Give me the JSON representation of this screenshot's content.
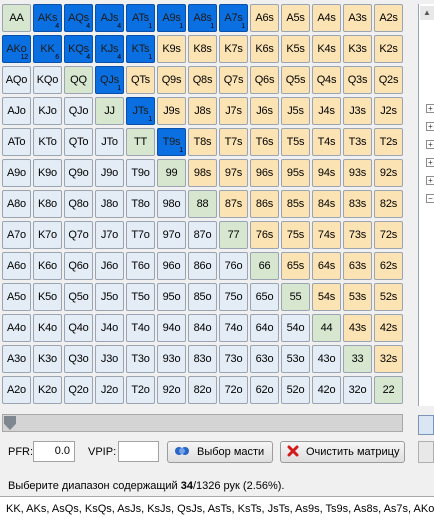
{
  "grid": {
    "rows": [
      [
        [
          "AA",
          "pair",
          false,
          ""
        ],
        [
          "AKs",
          "suited",
          true,
          "4"
        ],
        [
          "AQs",
          "suited",
          true,
          "4"
        ],
        [
          "AJs",
          "suited",
          true,
          "4"
        ],
        [
          "ATs",
          "suited",
          true,
          "1"
        ],
        [
          "A9s",
          "suited",
          true,
          "1"
        ],
        [
          "A8s",
          "suited",
          true,
          "1"
        ],
        [
          "A7s",
          "suited",
          true,
          "1"
        ],
        [
          "A6s",
          "suited",
          false,
          ""
        ],
        [
          "A5s",
          "suited",
          false,
          ""
        ],
        [
          "A4s",
          "suited",
          false,
          ""
        ],
        [
          "A3s",
          "suited",
          false,
          ""
        ],
        [
          "A2s",
          "suited",
          false,
          ""
        ]
      ],
      [
        [
          "AKo",
          "offsuit",
          true,
          "12"
        ],
        [
          "KK",
          "pair",
          true,
          "6"
        ],
        [
          "KQs",
          "suited",
          true,
          "4"
        ],
        [
          "KJs",
          "suited",
          true,
          "4"
        ],
        [
          "KTs",
          "suited",
          true,
          "1"
        ],
        [
          "K9s",
          "suited",
          false,
          ""
        ],
        [
          "K8s",
          "suited",
          false,
          ""
        ],
        [
          "K7s",
          "suited",
          false,
          ""
        ],
        [
          "K6s",
          "suited",
          false,
          ""
        ],
        [
          "K5s",
          "suited",
          false,
          ""
        ],
        [
          "K4s",
          "suited",
          false,
          ""
        ],
        [
          "K3s",
          "suited",
          false,
          ""
        ],
        [
          "K2s",
          "suited",
          false,
          ""
        ]
      ],
      [
        [
          "AQo",
          "offsuit",
          false,
          ""
        ],
        [
          "KQo",
          "offsuit",
          false,
          ""
        ],
        [
          "QQ",
          "pair",
          false,
          ""
        ],
        [
          "QJs",
          "suited",
          true,
          "1"
        ],
        [
          "QTs",
          "suited",
          false,
          ""
        ],
        [
          "Q9s",
          "suited",
          false,
          ""
        ],
        [
          "Q8s",
          "suited",
          false,
          ""
        ],
        [
          "Q7s",
          "suited",
          false,
          ""
        ],
        [
          "Q6s",
          "suited",
          false,
          ""
        ],
        [
          "Q5s",
          "suited",
          false,
          ""
        ],
        [
          "Q4s",
          "suited",
          false,
          ""
        ],
        [
          "Q3s",
          "suited",
          false,
          ""
        ],
        [
          "Q2s",
          "suited",
          false,
          ""
        ]
      ],
      [
        [
          "AJo",
          "offsuit",
          false,
          ""
        ],
        [
          "KJo",
          "offsuit",
          false,
          ""
        ],
        [
          "QJo",
          "offsuit",
          false,
          ""
        ],
        [
          "JJ",
          "pair",
          false,
          ""
        ],
        [
          "JTs",
          "suited",
          true,
          "1"
        ],
        [
          "J9s",
          "suited",
          false,
          ""
        ],
        [
          "J8s",
          "suited",
          false,
          ""
        ],
        [
          "J7s",
          "suited",
          false,
          ""
        ],
        [
          "J6s",
          "suited",
          false,
          ""
        ],
        [
          "J5s",
          "suited",
          false,
          ""
        ],
        [
          "J4s",
          "suited",
          false,
          ""
        ],
        [
          "J3s",
          "suited",
          false,
          ""
        ],
        [
          "J2s",
          "suited",
          false,
          ""
        ]
      ],
      [
        [
          "ATo",
          "offsuit",
          false,
          ""
        ],
        [
          "KTo",
          "offsuit",
          false,
          ""
        ],
        [
          "QTo",
          "offsuit",
          false,
          ""
        ],
        [
          "JTo",
          "offsuit",
          false,
          ""
        ],
        [
          "TT",
          "pair",
          false,
          ""
        ],
        [
          "T9s",
          "suited",
          true,
          "1"
        ],
        [
          "T8s",
          "suited",
          false,
          ""
        ],
        [
          "T7s",
          "suited",
          false,
          ""
        ],
        [
          "T6s",
          "suited",
          false,
          ""
        ],
        [
          "T5s",
          "suited",
          false,
          ""
        ],
        [
          "T4s",
          "suited",
          false,
          ""
        ],
        [
          "T3s",
          "suited",
          false,
          ""
        ],
        [
          "T2s",
          "suited",
          false,
          ""
        ]
      ],
      [
        [
          "A9o",
          "offsuit",
          false,
          ""
        ],
        [
          "K9o",
          "offsuit",
          false,
          ""
        ],
        [
          "Q9o",
          "offsuit",
          false,
          ""
        ],
        [
          "J9o",
          "offsuit",
          false,
          ""
        ],
        [
          "T9o",
          "offsuit",
          false,
          ""
        ],
        [
          "99",
          "pair",
          false,
          ""
        ],
        [
          "98s",
          "suited",
          false,
          ""
        ],
        [
          "97s",
          "suited",
          false,
          ""
        ],
        [
          "96s",
          "suited",
          false,
          ""
        ],
        [
          "95s",
          "suited",
          false,
          ""
        ],
        [
          "94s",
          "suited",
          false,
          ""
        ],
        [
          "93s",
          "suited",
          false,
          ""
        ],
        [
          "92s",
          "suited",
          false,
          ""
        ]
      ],
      [
        [
          "A8o",
          "offsuit",
          false,
          ""
        ],
        [
          "K8o",
          "offsuit",
          false,
          ""
        ],
        [
          "Q8o",
          "offsuit",
          false,
          ""
        ],
        [
          "J8o",
          "offsuit",
          false,
          ""
        ],
        [
          "T8o",
          "offsuit",
          false,
          ""
        ],
        [
          "98o",
          "offsuit",
          false,
          ""
        ],
        [
          "88",
          "pair",
          false,
          ""
        ],
        [
          "87s",
          "suited",
          false,
          ""
        ],
        [
          "86s",
          "suited",
          false,
          ""
        ],
        [
          "85s",
          "suited",
          false,
          ""
        ],
        [
          "84s",
          "suited",
          false,
          ""
        ],
        [
          "83s",
          "suited",
          false,
          ""
        ],
        [
          "82s",
          "suited",
          false,
          ""
        ]
      ],
      [
        [
          "A7o",
          "offsuit",
          false,
          ""
        ],
        [
          "K7o",
          "offsuit",
          false,
          ""
        ],
        [
          "Q7o",
          "offsuit",
          false,
          ""
        ],
        [
          "J7o",
          "offsuit",
          false,
          ""
        ],
        [
          "T7o",
          "offsuit",
          false,
          ""
        ],
        [
          "97o",
          "offsuit",
          false,
          ""
        ],
        [
          "87o",
          "offsuit",
          false,
          ""
        ],
        [
          "77",
          "pair",
          false,
          ""
        ],
        [
          "76s",
          "suited",
          false,
          ""
        ],
        [
          "75s",
          "suited",
          false,
          ""
        ],
        [
          "74s",
          "suited",
          false,
          ""
        ],
        [
          "73s",
          "suited",
          false,
          ""
        ],
        [
          "72s",
          "suited",
          false,
          ""
        ]
      ],
      [
        [
          "A6o",
          "offsuit",
          false,
          ""
        ],
        [
          "K6o",
          "offsuit",
          false,
          ""
        ],
        [
          "Q6o",
          "offsuit",
          false,
          ""
        ],
        [
          "J6o",
          "offsuit",
          false,
          ""
        ],
        [
          "T6o",
          "offsuit",
          false,
          ""
        ],
        [
          "96o",
          "offsuit",
          false,
          ""
        ],
        [
          "86o",
          "offsuit",
          false,
          ""
        ],
        [
          "76o",
          "offsuit",
          false,
          ""
        ],
        [
          "66",
          "pair",
          false,
          ""
        ],
        [
          "65s",
          "suited",
          false,
          ""
        ],
        [
          "64s",
          "suited",
          false,
          ""
        ],
        [
          "63s",
          "suited",
          false,
          ""
        ],
        [
          "62s",
          "suited",
          false,
          ""
        ]
      ],
      [
        [
          "A5o",
          "offsuit",
          false,
          ""
        ],
        [
          "K5o",
          "offsuit",
          false,
          ""
        ],
        [
          "Q5o",
          "offsuit",
          false,
          ""
        ],
        [
          "J5o",
          "offsuit",
          false,
          ""
        ],
        [
          "T5o",
          "offsuit",
          false,
          ""
        ],
        [
          "95o",
          "offsuit",
          false,
          ""
        ],
        [
          "85o",
          "offsuit",
          false,
          ""
        ],
        [
          "75o",
          "offsuit",
          false,
          ""
        ],
        [
          "65o",
          "offsuit",
          false,
          ""
        ],
        [
          "55",
          "pair",
          false,
          ""
        ],
        [
          "54s",
          "suited",
          false,
          ""
        ],
        [
          "53s",
          "suited",
          false,
          ""
        ],
        [
          "52s",
          "suited",
          false,
          ""
        ]
      ],
      [
        [
          "A4o",
          "offsuit",
          false,
          ""
        ],
        [
          "K4o",
          "offsuit",
          false,
          ""
        ],
        [
          "Q4o",
          "offsuit",
          false,
          ""
        ],
        [
          "J4o",
          "offsuit",
          false,
          ""
        ],
        [
          "T4o",
          "offsuit",
          false,
          ""
        ],
        [
          "94o",
          "offsuit",
          false,
          ""
        ],
        [
          "84o",
          "offsuit",
          false,
          ""
        ],
        [
          "74o",
          "offsuit",
          false,
          ""
        ],
        [
          "64o",
          "offsuit",
          false,
          ""
        ],
        [
          "54o",
          "offsuit",
          false,
          ""
        ],
        [
          "44",
          "pair",
          false,
          ""
        ],
        [
          "43s",
          "suited",
          false,
          ""
        ],
        [
          "42s",
          "suited",
          false,
          ""
        ]
      ],
      [
        [
          "A3o",
          "offsuit",
          false,
          ""
        ],
        [
          "K3o",
          "offsuit",
          false,
          ""
        ],
        [
          "Q3o",
          "offsuit",
          false,
          ""
        ],
        [
          "J3o",
          "offsuit",
          false,
          ""
        ],
        [
          "T3o",
          "offsuit",
          false,
          ""
        ],
        [
          "93o",
          "offsuit",
          false,
          ""
        ],
        [
          "83o",
          "offsuit",
          false,
          ""
        ],
        [
          "73o",
          "offsuit",
          false,
          ""
        ],
        [
          "63o",
          "offsuit",
          false,
          ""
        ],
        [
          "53o",
          "offsuit",
          false,
          ""
        ],
        [
          "43o",
          "offsuit",
          false,
          ""
        ],
        [
          "33",
          "pair",
          false,
          ""
        ],
        [
          "32s",
          "suited",
          false,
          ""
        ]
      ],
      [
        [
          "A2o",
          "offsuit",
          false,
          ""
        ],
        [
          "K2o",
          "offsuit",
          false,
          ""
        ],
        [
          "Q2o",
          "offsuit",
          false,
          ""
        ],
        [
          "J2o",
          "offsuit",
          false,
          ""
        ],
        [
          "T2o",
          "offsuit",
          false,
          ""
        ],
        [
          "92o",
          "offsuit",
          false,
          ""
        ],
        [
          "82o",
          "offsuit",
          false,
          ""
        ],
        [
          "72o",
          "offsuit",
          false,
          ""
        ],
        [
          "62o",
          "offsuit",
          false,
          ""
        ],
        [
          "52o",
          "offsuit",
          false,
          ""
        ],
        [
          "42o",
          "offsuit",
          false,
          ""
        ],
        [
          "32o",
          "offsuit",
          false,
          ""
        ],
        [
          "22",
          "pair",
          false,
          ""
        ]
      ]
    ]
  },
  "controls": {
    "pfr_label": "PFR:",
    "pfr_value": "0.0",
    "vpip_label": "VPIP:",
    "vpip_value": "",
    "suit_button": "Выбор масти",
    "clear_button": "Очистить матрицу"
  },
  "status": {
    "prefix": "Выберите диапазон содержащий ",
    "count": "34",
    "suffix": "/1326 рук (2.56%)."
  },
  "hands_text": "KK, AKs, AsQs, KsQs, AsJs, KsJs, QsJs, AsTs, KsTs, JsTs, As9s, Ts9s, As8s, As7s, AKo",
  "colors": {
    "pair": "#d7e6cf",
    "suited": "#fbe3b4",
    "offsuit": "#e4edf6",
    "selected": "#0a6fe0"
  },
  "icons": {
    "suit_button_icon": "suit-selector-icon",
    "clear_button_icon": "red-x-icon",
    "slider_thumb": "slider-thumb-icon"
  }
}
